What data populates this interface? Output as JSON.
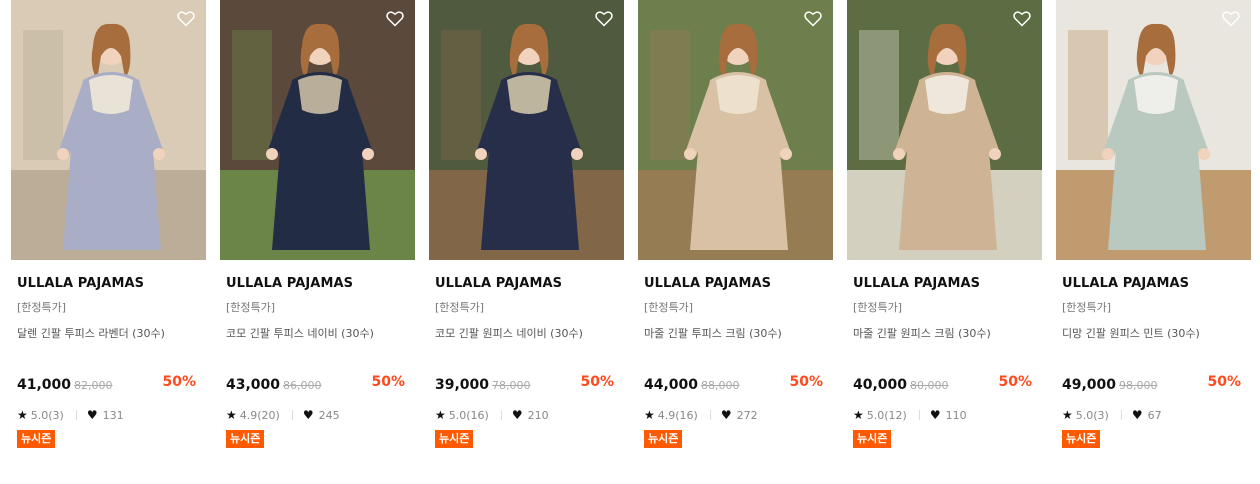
{
  "products": [
    {
      "brand": "ULLALA PAJAMAS",
      "tag": "[한정특가]",
      "name": "달렌 긴팔 투피스 라벤더 (30수)",
      "price": "41,000",
      "original_price": "82,000",
      "discount": "50%",
      "rating": "5.0(3)",
      "likes": "131",
      "badge": "뉴시즌",
      "image_desc": "lavender ruffle pajama set",
      "palette": {
        "bg": "#d9cbb6",
        "accent": "#b5a892",
        "garment": "#a9aec6",
        "detail": "#efe8d8"
      }
    },
    {
      "brand": "ULLALA PAJAMAS",
      "tag": "[한정특가]",
      "name": "코모 긴팔 투피스 네이비 (30수)",
      "price": "43,000",
      "original_price": "86,000",
      "discount": "50%",
      "rating": "4.9(20)",
      "likes": "245",
      "badge": "뉴시즌",
      "image_desc": "navy pajama set with lace collar",
      "palette": {
        "bg": "#5b4a3c",
        "accent": "#6f8f4a",
        "garment": "#232c45",
        "detail": "#c9bda2"
      }
    },
    {
      "brand": "ULLALA PAJAMAS",
      "tag": "[한정특가]",
      "name": "코모 긴팔 원피스 네이비 (30수)",
      "price": "39,000",
      "original_price": "78,000",
      "discount": "50%",
      "rating": "5.0(16)",
      "likes": "210",
      "badge": "뉴시즌",
      "image_desc": "navy nightgown with lace collar",
      "palette": {
        "bg": "#4f5a3e",
        "accent": "#8a6a4a",
        "garment": "#262e4a",
        "detail": "#cfc4a8"
      }
    },
    {
      "brand": "ULLALA PAJAMAS",
      "tag": "[한정특가]",
      "name": "마줄 긴팔 투피스 크림 (30수)",
      "price": "44,000",
      "original_price": "88,000",
      "discount": "50%",
      "rating": "4.9(16)",
      "likes": "272",
      "badge": "뉴시즌",
      "image_desc": "cream floral pajama set",
      "palette": {
        "bg": "#6d7f4c",
        "accent": "#9c7b55",
        "garment": "#d8c1a4",
        "detail": "#efe4d2"
      }
    },
    {
      "brand": "ULLALA PAJAMAS",
      "tag": "[한정특가]",
      "name": "마줄 긴팔 원피스 크림 (30수)",
      "price": "40,000",
      "original_price": "80,000",
      "discount": "50%",
      "rating": "5.0(12)",
      "likes": "110",
      "badge": "뉴시즌",
      "image_desc": "cream floral nightgown",
      "palette": {
        "bg": "#5d6d43",
        "accent": "#e8e2d6",
        "garment": "#cfb395",
        "detail": "#f2ece2"
      }
    },
    {
      "brand": "ULLALA PAJAMAS",
      "tag": "[한정특가]",
      "name": "디망 긴팔 원피스 민트 (30수)",
      "price": "49,000",
      "original_price": "98,000",
      "discount": "50%",
      "rating": "5.0(3)",
      "likes": "67",
      "badge": "뉴시즌",
      "image_desc": "mint nightgown",
      "palette": {
        "bg": "#e9e6e0",
        "accent": "#b98d5a",
        "garment": "#b9c9bf",
        "detail": "#f4f2ee"
      }
    }
  ],
  "icons": {
    "wishlist": "heart-outline-icon",
    "rating": "star-icon",
    "likes": "heart-icon"
  }
}
